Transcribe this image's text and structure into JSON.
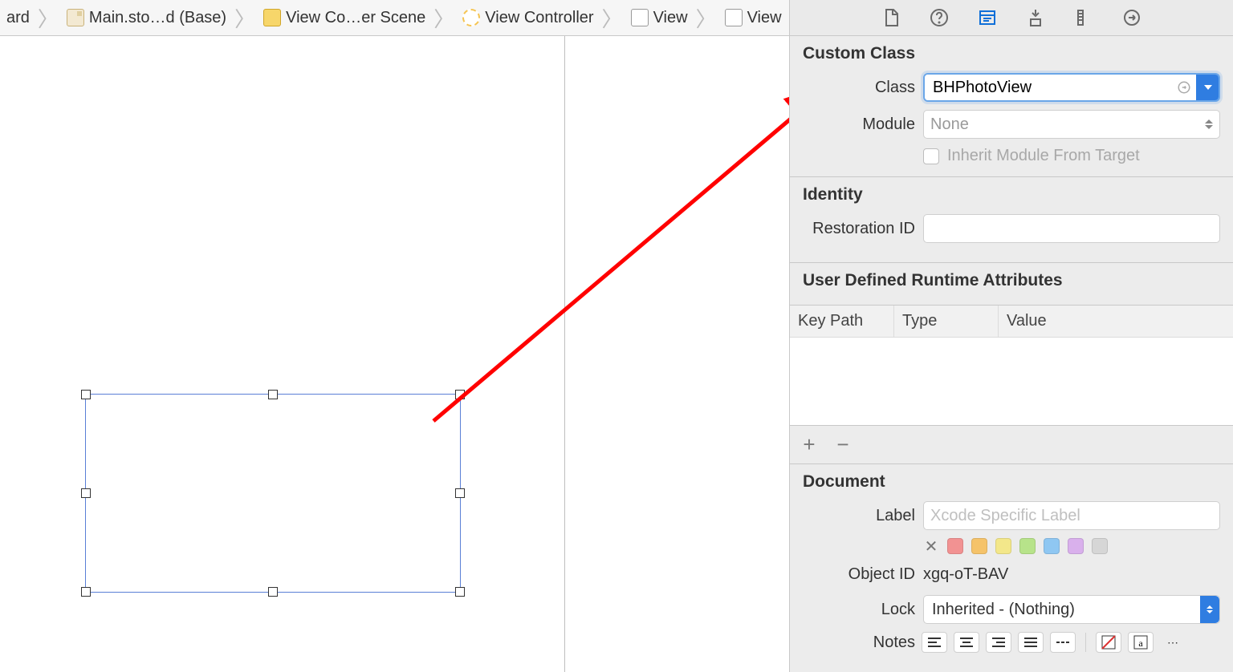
{
  "breadcrumb": {
    "items": [
      {
        "label": "ard",
        "kind": "project"
      },
      {
        "label": "Main.sto…d (Base)",
        "kind": "file"
      },
      {
        "label": "View Co…er Scene",
        "kind": "scene"
      },
      {
        "label": "View Controller",
        "kind": "controller"
      },
      {
        "label": "View",
        "kind": "view"
      },
      {
        "label": "View",
        "kind": "view"
      }
    ]
  },
  "sections": {
    "custom_class": {
      "title": "Custom Class",
      "class_label": "Class",
      "class_value": "BHPhotoView",
      "module_label": "Module",
      "module_placeholder": "None",
      "inherit_label": "Inherit Module From Target",
      "inherit_checked": false
    },
    "identity": {
      "title": "Identity",
      "restoration_label": "Restoration ID",
      "restoration_value": ""
    },
    "runtime_attrs": {
      "title": "User Defined Runtime Attributes",
      "columns": {
        "c1": "Key Path",
        "c2": "Type",
        "c3": "Value"
      },
      "rows": []
    },
    "document": {
      "title": "Document",
      "label_label": "Label",
      "label_placeholder": "Xcode Specific Label",
      "colors": [
        "#f29292",
        "#f5c36a",
        "#f3e78a",
        "#b7e38a",
        "#8fc7f2",
        "#d9b0ec",
        "#d6d6d6"
      ],
      "object_id_label": "Object ID",
      "object_id_value": "xgq-oT-BAV",
      "lock_label": "Lock",
      "lock_value": "Inherited - (Nothing)",
      "notes_label": "Notes"
    }
  }
}
